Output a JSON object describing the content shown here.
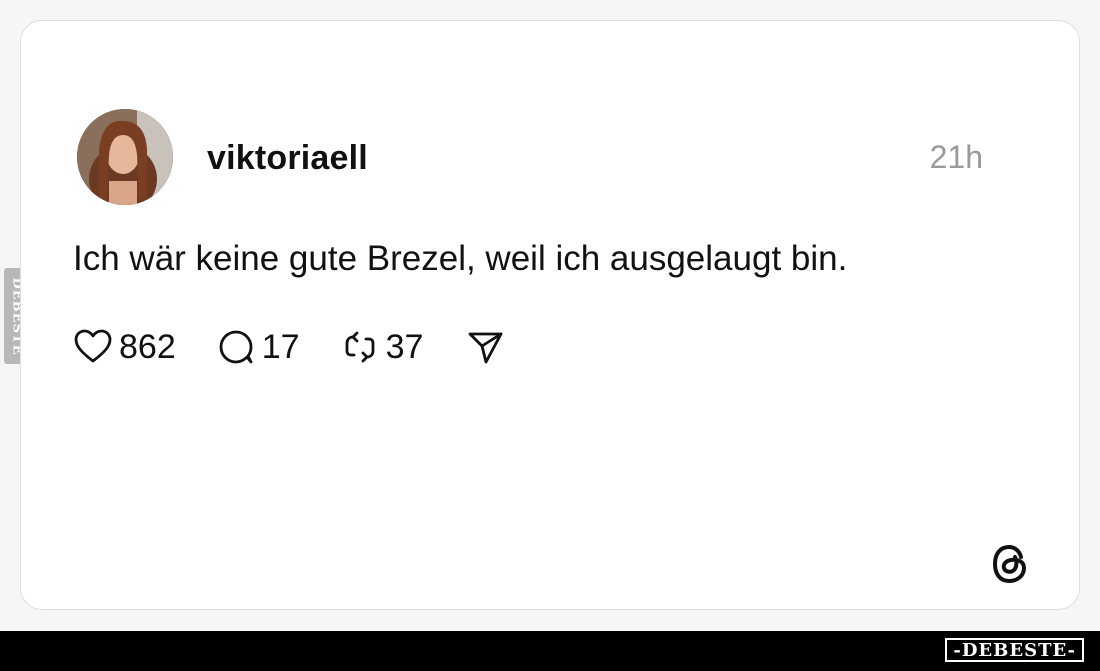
{
  "post": {
    "username": "viktoriaell",
    "timestamp": "21h",
    "text": "Ich wär keine gute Brezel, weil ich ausgelaugt bin.",
    "likes": "862",
    "replies": "17",
    "reposts": "37"
  },
  "icons": {
    "like": "heart-icon",
    "reply": "speech-bubble-icon",
    "repost": "repost-arrows-icon",
    "share": "paper-plane-icon",
    "brand": "threads-logo-icon"
  },
  "watermark": {
    "side_text": "DEBESTE",
    "footer_text": "-DEBESTE-"
  },
  "colors": {
    "text": "#111111",
    "muted": "#9a9a9a",
    "card_border": "#dedede",
    "footer_bg": "#000000"
  }
}
